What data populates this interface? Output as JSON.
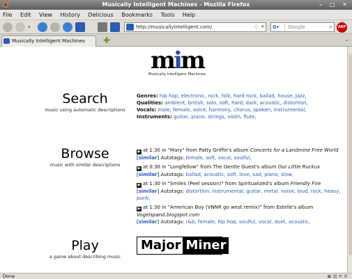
{
  "window": {
    "title": "Musically Intelligent Machines - Mozilla Firefox",
    "controls": "– □ ✕"
  },
  "menu": [
    "File",
    "Edit",
    "View",
    "History",
    "Delicious",
    "Bookmarks",
    "Tools",
    "Help"
  ],
  "nav": {
    "url": "http://musicallyintelligent.com/",
    "search_placeholder": "Google",
    "abp_label": "ABP"
  },
  "tab": {
    "label": "Musically Intelligent Machines"
  },
  "status": {
    "text": "Done"
  },
  "logo": {
    "mark_m1": "m",
    "mark_i": "i",
    "mark_m2": "m",
    "tagline": "Musically Intelligent Machines"
  },
  "search": {
    "heading": "Search",
    "subheading": "music using automatic descriptions",
    "rows": [
      {
        "label": "Genres:",
        "items": "hip hop, electronic, rock, folk, hard rock, ballad, house, jazz,"
      },
      {
        "label": "Qualities:",
        "items": "ambient, british, solo, soft, hard, dark, acoustic, distortion,"
      },
      {
        "label": "Vocals:",
        "items": "male, female, voice, harmony, chorus, spoken, instrumental,"
      },
      {
        "label": "Instruments:",
        "items": "guitar, piano, strings, violin, flute,"
      }
    ]
  },
  "browse": {
    "heading": "Browse",
    "subheading": "music with similar descriptions",
    "entries": [
      {
        "prefix": "at 1:30 in \"Mary\" from Patty Griffin's album ",
        "album": "Concerts for a Landmine Free World",
        "similar": "similar",
        "autotags_label": "Autotags:",
        "tags": "female, soft, vocal, soulful,"
      },
      {
        "prefix": "at 0:30 in \"Longfellow\" from The Gentle Guest's album ",
        "album": "Our Little Ruckus",
        "similar": "similar",
        "autotags_label": "Autotags:",
        "tags": "ballad, acoustic, soft, love, sad, piano, slow,"
      },
      {
        "prefix": "at 1:30 in \"Smiles (Peel session)\" from Spiritualized's album ",
        "album": "Friendly Fire",
        "similar": "similar",
        "autotags_label": "Autotags:",
        "tags": "distortion, instrumental, guitar, metal, noise, loud, rock, heavy, punk,"
      },
      {
        "prefix": "at 1:30 in \"American Boy (VNNR go west remix)\" from Estelle's album ",
        "album": "Vogelspand.blogspot.com",
        "similar": "similar",
        "autotags_label": "Autotags:",
        "tags": "r&b, female, hip hop, soulful, vocal, duet, acoustic,"
      }
    ]
  },
  "play": {
    "heading": "Play",
    "subheading": "a game about describing music",
    "logo_major": "Major",
    "logo_miner": "Miner"
  }
}
